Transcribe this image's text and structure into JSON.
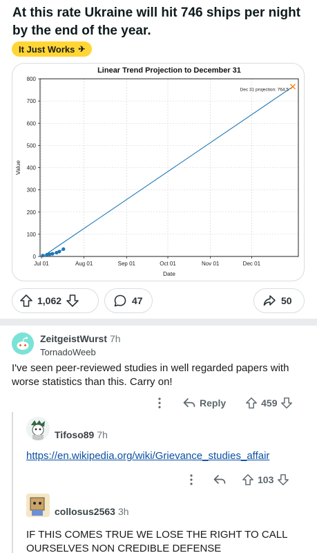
{
  "post": {
    "title": "At this rate Ukraine will hit 746 ships per night by the end of the year.",
    "flair": "It Just Works",
    "flair_emoji": "✈️",
    "flair_color": "#ffd635"
  },
  "chart_data": {
    "type": "line",
    "title": "Linear Trend Projection to December 31",
    "xlabel": "Date",
    "ylabel": "Value",
    "xlim": [
      "2024-06-30",
      "2025-01-04"
    ],
    "ylim": [
      0,
      800
    ],
    "x_ticks": [
      "Jul 01",
      "Aug 01",
      "Sep 01",
      "Oct 01",
      "Nov 01",
      "Dec 01"
    ],
    "y_ticks": [
      0,
      100,
      200,
      300,
      400,
      500,
      600,
      700,
      800
    ],
    "grid": true,
    "series": [
      {
        "kind": "points",
        "x": [
          "2024-07-02",
          "2024-07-05",
          "2024-07-07",
          "2024-07-09",
          "2024-07-12",
          "2024-07-14",
          "2024-07-17"
        ],
        "y": [
          4,
          8,
          10,
          12,
          17,
          22,
          33
        ],
        "color": "#1f77b4"
      },
      {
        "kind": "line",
        "x": [
          "2024-07-02",
          "2024-12-31"
        ],
        "y": [
          0,
          764.5
        ],
        "color": "#1f77b4"
      },
      {
        "kind": "marker",
        "x": [
          "2024-12-31"
        ],
        "y": [
          764.5
        ],
        "color": "#ff7f0e"
      }
    ],
    "annotation": "Dec 31 projection: 764.5"
  },
  "actions": {
    "score": "1,062",
    "comments": "47",
    "shares": "50"
  },
  "comments": [
    {
      "username": "ZeitgeistWurst",
      "age": "7h",
      "flair": "TornadoWeeb",
      "text": "I've seen peer-reviewed studies in well regarded papers with worse statistics than this. Carry on!",
      "reply_label": "Reply",
      "score": "459"
    },
    {
      "username": "Tifoso89",
      "age": "7h",
      "link": "https://en.wikipedia.org/wiki/Grievance_studies_affair",
      "score": "103"
    },
    {
      "username": "collosus2563",
      "age": "3h",
      "text": "IF THIS COMES TRUE WE LOSE THE RIGHT TO CALL OURSELVES NON CREDIBLE DEFENSE"
    }
  ],
  "icons": {
    "upvote": "upvote-arrow-icon",
    "downvote": "downvote-arrow-icon",
    "comment": "comment-bubble-icon",
    "share": "share-arrow-icon",
    "reply": "reply-arrow-icon",
    "more": "more-vertical-icon"
  }
}
